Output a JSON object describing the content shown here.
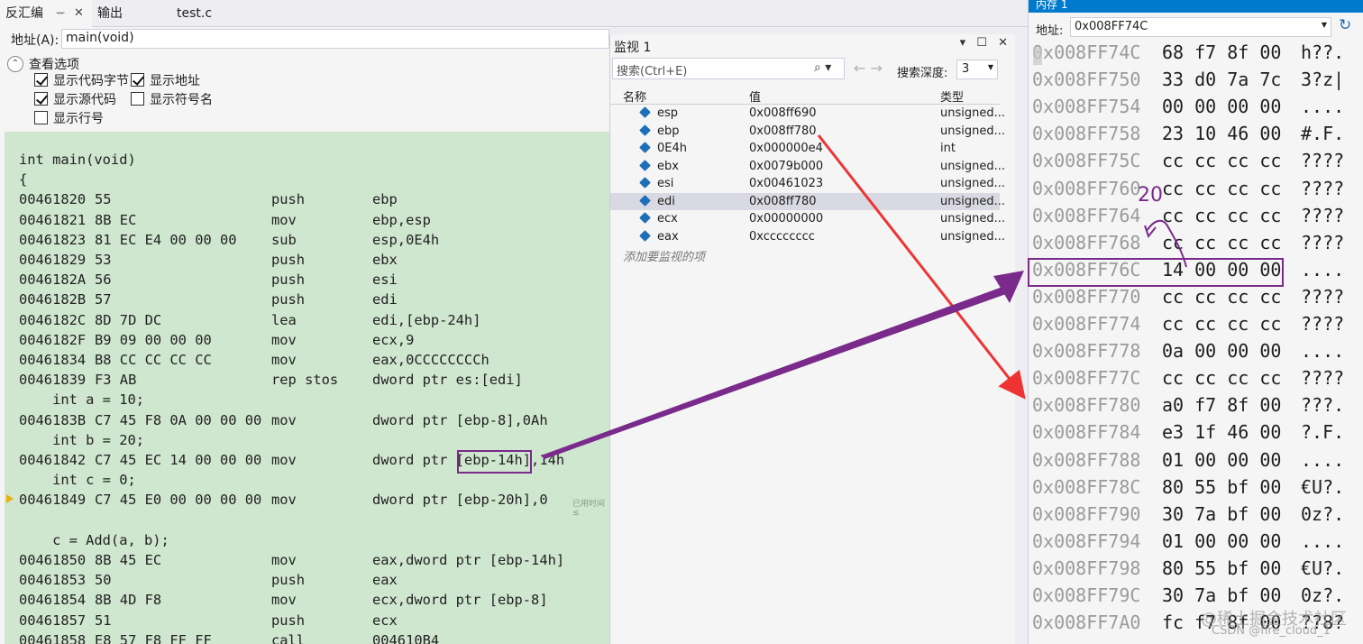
{
  "tabs": {
    "disassembly": "反汇编",
    "pin_glyph": "ᅲ",
    "close_glyph": "✕",
    "output": "输出",
    "file": "test.c"
  },
  "disasm": {
    "address_label": "地址(A):",
    "address_value": "main(void)",
    "view_options_title": "查看选项",
    "toggle_glyph": "⌃",
    "options": {
      "show_code_bytes": "显示代码字节",
      "show_address": "显示地址",
      "show_source": "显示源代码",
      "show_symbol_names": "显示符号名",
      "show_line_numbers": "显示行号"
    },
    "elapsed": "已用时间 ≤",
    "lines": [
      {
        "src": "int main(void)"
      },
      {
        "src": "{"
      },
      {
        "addr": "00461820",
        "bytes": "55",
        "op": "push",
        "arg": "ebp"
      },
      {
        "addr": "00461821",
        "bytes": "8B EC",
        "op": "mov",
        "arg": "ebp,esp"
      },
      {
        "addr": "00461823",
        "bytes": "81 EC E4 00 00 00",
        "op": "sub",
        "arg": "esp,0E4h"
      },
      {
        "addr": "00461829",
        "bytes": "53",
        "op": "push",
        "arg": "ebx"
      },
      {
        "addr": "0046182A",
        "bytes": "56",
        "op": "push",
        "arg": "esi"
      },
      {
        "addr": "0046182B",
        "bytes": "57",
        "op": "push",
        "arg": "edi"
      },
      {
        "addr": "0046182C",
        "bytes": "8D 7D DC",
        "op": "lea",
        "arg": "edi,[ebp-24h]"
      },
      {
        "addr": "0046182F",
        "bytes": "B9 09 00 00 00",
        "op": "mov",
        "arg": "ecx,9"
      },
      {
        "addr": "00461834",
        "bytes": "B8 CC CC CC CC",
        "op": "mov",
        "arg": "eax,0CCCCCCCCh"
      },
      {
        "addr": "00461839",
        "bytes": "F3 AB",
        "op": "rep stos",
        "arg": "dword ptr es:[edi]"
      },
      {
        "src": "    int a = 10;"
      },
      {
        "addr": "0046183B",
        "bytes": "C7 45 F8 0A 00 00 00",
        "op": "mov",
        "arg": "dword ptr [ebp-8],0Ah"
      },
      {
        "src": "    int b = 20;"
      },
      {
        "addr": "00461842",
        "bytes": "C7 45 EC 14 00 00 00",
        "op": "mov",
        "arg": "dword ptr [ebp-14h],14h"
      },
      {
        "src": "    int c = 0;"
      },
      {
        "addr": "00461849",
        "bytes": "C7 45 E0 00 00 00 00",
        "op": "mov",
        "arg": "dword ptr [ebp-20h],0"
      },
      {
        "src": ""
      },
      {
        "src": "    c = Add(a, b);"
      },
      {
        "addr": "00461850",
        "bytes": "8B 45 EC",
        "op": "mov",
        "arg": "eax,dword ptr [ebp-14h]"
      },
      {
        "addr": "00461853",
        "bytes": "50",
        "op": "push",
        "arg": "eax"
      },
      {
        "addr": "00461854",
        "bytes": "8B 4D F8",
        "op": "mov",
        "arg": "ecx,dword ptr [ebp-8]"
      },
      {
        "addr": "00461857",
        "bytes": "51",
        "op": "push",
        "arg": "ecx"
      },
      {
        "addr": "00461858",
        "bytes": "E8 57 F8 FF FF",
        "op": "call",
        "arg": "004610B4"
      }
    ]
  },
  "watch": {
    "title": "监视 1",
    "ctrl_dropdown": "▾",
    "ctrl_maximize": "☐",
    "ctrl_close": "✕",
    "search_placeholder": "搜索(Ctrl+E)",
    "search_icon": "⌕ ▾",
    "nav": "←  →",
    "depth_label": "搜索深度:",
    "depth_value": "3",
    "dropdown_glyph": "▼",
    "col_name": "名称",
    "col_value": "值",
    "col_type": "类型",
    "rows": [
      {
        "name": "esp",
        "value": "0x008ff690",
        "type": "unsigned..."
      },
      {
        "name": "ebp",
        "value": "0x008ff780",
        "type": "unsigned..."
      },
      {
        "name": "0E4h",
        "value": "0x000000e4",
        "type": "int"
      },
      {
        "name": "ebx",
        "value": "0x0079b000",
        "type": "unsigned..."
      },
      {
        "name": "esi",
        "value": "0x00461023",
        "type": "unsigned..."
      },
      {
        "name": "edi",
        "value": "0x008ff780",
        "type": "unsigned..."
      },
      {
        "name": "ecx",
        "value": "0x00000000",
        "type": "unsigned..."
      },
      {
        "name": "eax",
        "value": "0xcccccccc",
        "type": "unsigned..."
      }
    ],
    "selected_row": 5,
    "add_item": "添加要监视的项"
  },
  "memory": {
    "title": "内存 1",
    "address_label": "地址:",
    "address_value": "0x008FF74C",
    "dropdown_glyph": "▼",
    "refresh_glyph": "↻",
    "rows": [
      {
        "addr": "0x008FF74C",
        "bytes": "68 f7 8f 00",
        "ascii": "h??."
      },
      {
        "addr": "0x008FF750",
        "bytes": "33 d0 7a 7c",
        "ascii": "3?z|"
      },
      {
        "addr": "0x008FF754",
        "bytes": "00 00 00 00",
        "ascii": "...."
      },
      {
        "addr": "0x008FF758",
        "bytes": "23 10 46 00",
        "ascii": "#.F."
      },
      {
        "addr": "0x008FF75C",
        "bytes": "cc cc cc cc",
        "ascii": "????"
      },
      {
        "addr": "0x008FF760",
        "bytes": "cc cc cc cc",
        "ascii": "????"
      },
      {
        "addr": "0x008FF764",
        "bytes": "cc cc cc cc",
        "ascii": "????"
      },
      {
        "addr": "0x008FF768",
        "bytes": "cc cc cc cc",
        "ascii": "????"
      },
      {
        "addr": "0x008FF76C",
        "bytes": "14 00 00 00",
        "ascii": "...."
      },
      {
        "addr": "0x008FF770",
        "bytes": "cc cc cc cc",
        "ascii": "????"
      },
      {
        "addr": "0x008FF774",
        "bytes": "cc cc cc cc",
        "ascii": "????"
      },
      {
        "addr": "0x008FF778",
        "bytes": "0a 00 00 00",
        "ascii": "...."
      },
      {
        "addr": "0x008FF77C",
        "bytes": "cc cc cc cc",
        "ascii": "????"
      },
      {
        "addr": "0x008FF780",
        "bytes": "a0 f7 8f 00",
        "ascii": "???."
      },
      {
        "addr": "0x008FF784",
        "bytes": "e3 1f 46 00",
        "ascii": "?.F."
      },
      {
        "addr": "0x008FF788",
        "bytes": "01 00 00 00",
        "ascii": "...."
      },
      {
        "addr": "0x008FF78C",
        "bytes": "80 55 bf 00",
        "ascii": "€U?."
      },
      {
        "addr": "0x008FF790",
        "bytes": "30 7a bf 00",
        "ascii": "0z?."
      },
      {
        "addr": "0x008FF794",
        "bytes": "01 00 00 00",
        "ascii": "...."
      },
      {
        "addr": "0x008FF798",
        "bytes": "80 55 bf 00",
        "ascii": "€U?."
      },
      {
        "addr": "0x008FF79C",
        "bytes": "30 7a bf 00",
        "ascii": "0z?."
      },
      {
        "addr": "0x008FF7A0",
        "bytes": "fc f7 8f 00",
        "ascii": "??8?"
      }
    ]
  },
  "annotation": {
    "value": "20"
  },
  "watermark": {
    "line1": "@稀土掘金技术社区",
    "line2": "CSDN @fire_cloud_1"
  },
  "colors": {
    "annotation_purple": "#7a2a8a",
    "arrow_red": "#ee3333",
    "code_background": "#cfe6cf",
    "accent_blue": "#007acc"
  }
}
